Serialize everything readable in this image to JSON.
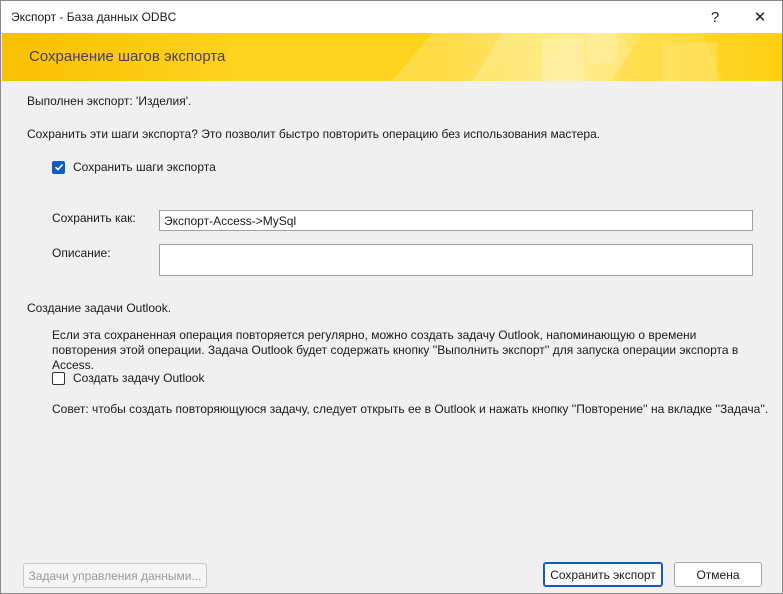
{
  "window": {
    "title": "Экспорт - База данных ODBC",
    "help_glyph": "?",
    "close_glyph": "✕"
  },
  "banner": {
    "title": "Сохранение шагов экспорта"
  },
  "status": {
    "done_text": "Выполнен экспорт: 'Изделия'."
  },
  "prompt": {
    "question": "Сохранить эти шаги экспорта? Это позволит быстро повторить операцию без использования мастера."
  },
  "save_steps": {
    "checked": true,
    "label": "Сохранить шаги экспорта"
  },
  "form": {
    "save_as_label": "Сохранить как:",
    "save_as_value": "Экспорт-Access->MySql",
    "description_label": "Описание:",
    "description_value": ""
  },
  "outlook": {
    "section_title": "Создание задачи Outlook.",
    "info": "Если эта сохраненная операция повторяется регулярно, можно создать задачу Outlook, напоминающую о времени повторения этой операции. Задача Outlook будет содержать кнопку ''Выполнить экспорт'' для запуска операции экспорта в Access.",
    "checkbox_label": "Создать задачу Outlook",
    "checked": false,
    "tip": "Совет: чтобы создать повторяющуюся задачу, следует открыть ее в Outlook и нажать кнопку ''Повторение'' на вкладке ''Задача''."
  },
  "footer": {
    "manage_label": "Задачи управления данными...",
    "save_export_label": "Сохранить экспорт",
    "cancel_label": "Отмена"
  },
  "colors": {
    "accent": "#0f5cc0",
    "banner_yellow": "#ffd21f",
    "banner_text": "#4a3f63"
  }
}
